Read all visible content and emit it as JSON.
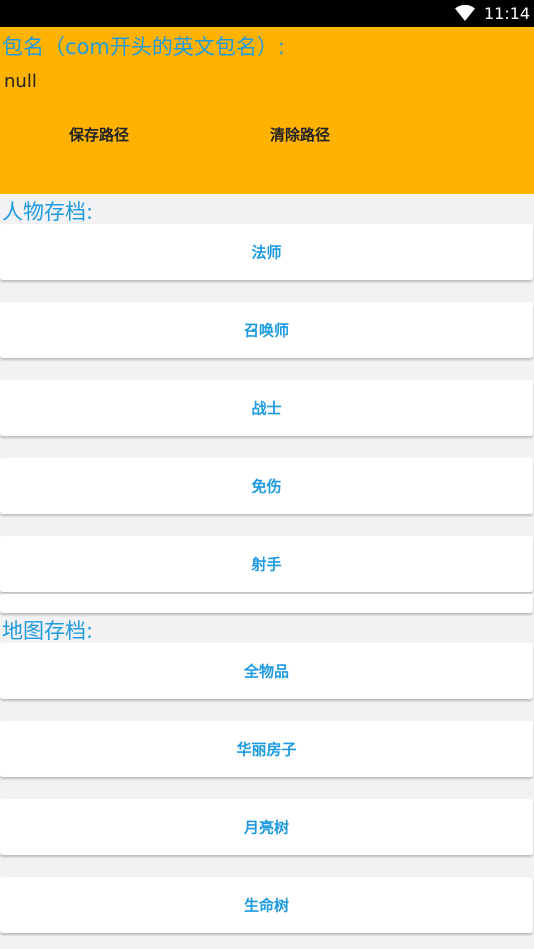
{
  "status_bar": {
    "time": "11:14",
    "wifi_icon": "wifi-icon"
  },
  "config": {
    "package_label": "包名（com开头的英文包名）:",
    "package_value": "null",
    "save_label": "保存路径",
    "clear_label": "清除路径",
    "background": "#ffb300"
  },
  "character_section": {
    "title": "人物存档:",
    "items": [
      "法师",
      "召唤师",
      "战士",
      "免伤",
      "射手"
    ]
  },
  "map_section": {
    "title": "地图存档:",
    "items": [
      "全物品",
      "华丽房子",
      "月亮树",
      "生命树"
    ]
  },
  "colors": {
    "accent": "#1e9be0",
    "status_bar": "#000000"
  }
}
